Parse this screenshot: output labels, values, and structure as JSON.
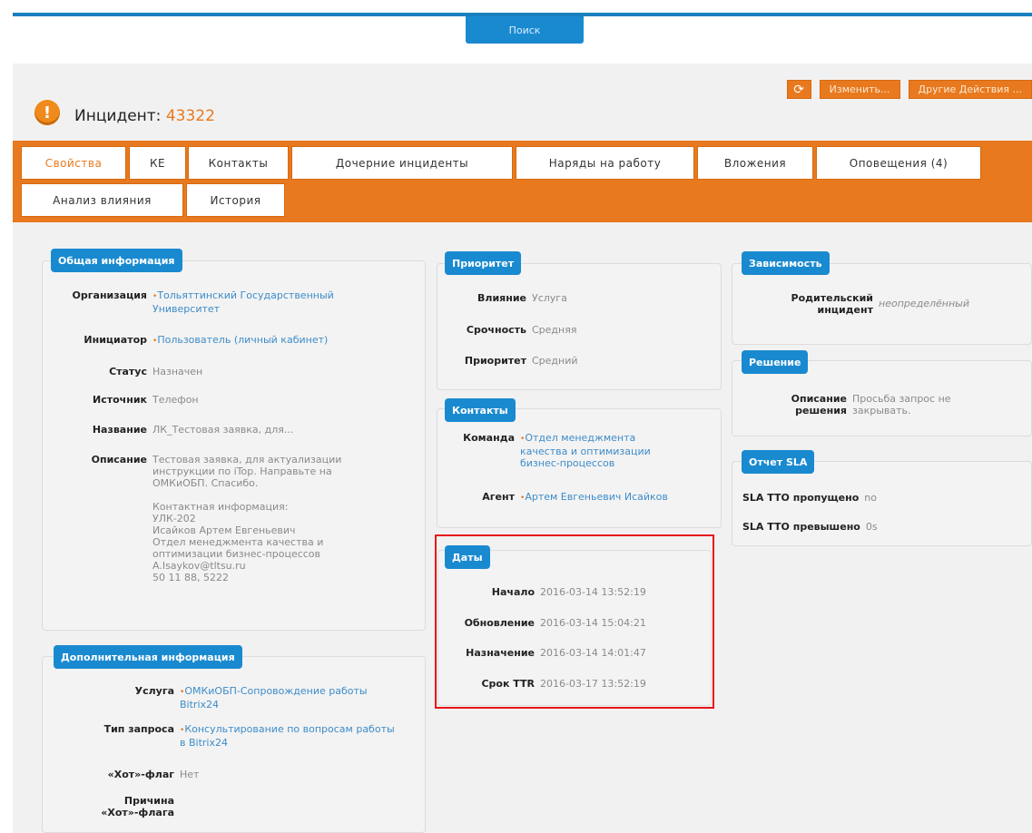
{
  "search": {
    "label": "Поиск"
  },
  "actions": {
    "refresh_icon": "refresh-icon",
    "edit": "Изменить...",
    "other": "Другие Действия ..."
  },
  "header": {
    "title": "Инцидент:",
    "number": "43322",
    "icon": "warning-icon"
  },
  "tabs": [
    "Свойства",
    "КЕ",
    "Контакты",
    "Дочерние инциденты",
    "Наряды на работу",
    "Вложения",
    "Оповещения (4)",
    "Анализ влияния",
    "История"
  ],
  "general": {
    "legend": "Общая информация",
    "org_label": "Организация",
    "org_value": "Тольяттинский Государственный Университет",
    "init_label": "Инициатор",
    "init_value": "Пользователь (личный кабинет)",
    "status_label": "Статус",
    "status_value": "Назначен",
    "source_label": "Источник",
    "source_value": "Телефон",
    "name_label": "Название",
    "name_value": "ЛК_Тестовая заявка, для...",
    "desc_label": "Описание",
    "desc_value": "Тестовая заявка, для актуализации инструкции по iTop. Направьте на ОМКиОБП. Спасибо.\n\nКонтактная информация:\nУЛК-202\nИсайков Артем Евгеньевич\nОтдел менеджмента качества и оптимизации бизнес-процессов\nA.Isaykov@tltsu.ru\n50 11 88, 5222"
  },
  "additional": {
    "legend": "Дополнительная информация",
    "service_label": "Услуга",
    "service_value": "ОМКиОБП-Сопровождение работы Bitrix24",
    "type_label": "Тип запроса",
    "type_value": "Консультирование по вопросам работы в Bitrix24",
    "hot_label": "«Хот»-флаг",
    "hot_value": "Нет",
    "reason_label": "Причина\n«Хот»-флага"
  },
  "priority": {
    "legend": "Приоритет",
    "impact_label": "Влияние",
    "impact_value": "Услуга",
    "urgency_label": "Срочность",
    "urgency_value": "Средняя",
    "priority_label": "Приоритет",
    "priority_value": "Средний"
  },
  "contacts": {
    "legend": "Контакты",
    "team_label": "Команда",
    "team_value": "Отдел менеджмента качества и оптимизации бизнес-процессов",
    "agent_label": "Агент",
    "agent_value": "Артем Евгеньевич Исайков"
  },
  "dates": {
    "legend": "Даты",
    "start_label": "Начало",
    "start_value": "2016-03-14 13:52:19",
    "update_label": "Обновление",
    "update_value": "2016-03-14 15:04:21",
    "assign_label": "Назначение",
    "assign_value": "2016-03-14 14:01:47",
    "ttr_label": "Срок TTR",
    "ttr_value": "2016-03-17 13:52:19"
  },
  "dependency": {
    "legend": "Зависимость",
    "parent_label": "Родительский инцидент",
    "parent_value": "неопределённый"
  },
  "resolution": {
    "legend": "Решение",
    "desc_label": "Описание решения",
    "desc_value": "Просьба запрос не закрывать."
  },
  "sla": {
    "legend": "Отчет SLA",
    "tto_missed_label": "SLA TTO пропущено",
    "tto_missed_value": "no",
    "tto_exceeded_label": "SLA TTO превышено",
    "tto_exceeded_value": "0s"
  }
}
